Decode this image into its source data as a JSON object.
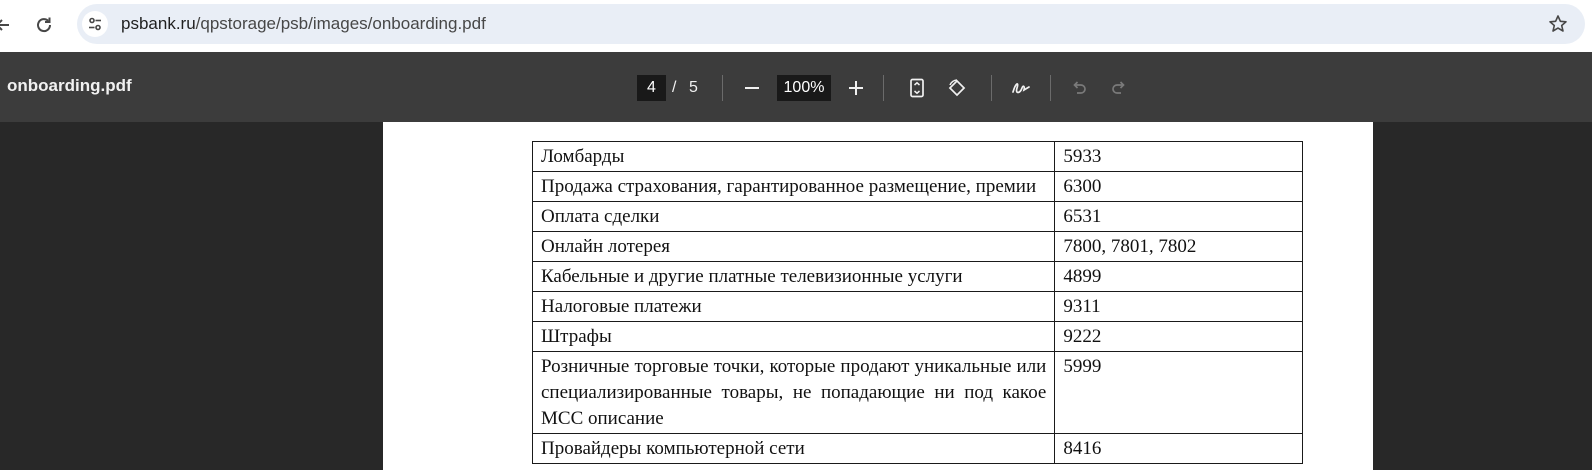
{
  "browser": {
    "url_host": "psbank.ru",
    "url_path": "/qpstorage/psb/images/onboarding.pdf",
    "icons": {
      "back": "arrow-left-icon",
      "reload": "reload-icon",
      "site_info": "tune-icon",
      "bookmark": "star-icon"
    }
  },
  "pdf_toolbar": {
    "title": "onboarding.pdf",
    "current_page": "4",
    "page_separator": "/",
    "total_pages": "5",
    "zoom": "100%",
    "icons": [
      "minus-icon",
      "plus-icon",
      "fit-page-icon",
      "rotate-icon",
      "draw-icon",
      "undo-icon",
      "redo-icon"
    ]
  },
  "document": {
    "rows": [
      {
        "name": "Ломбарды",
        "code": "5933"
      },
      {
        "name": "Продажа страхования, гарантированное размещение, премии",
        "code": "6300"
      },
      {
        "name": "Оплата сделки",
        "code": "6531"
      },
      {
        "name": "Онлайн лотерея",
        "code": "7800, 7801, 7802"
      },
      {
        "name": "Кабельные и другие платные телевизионные услуги",
        "code": "4899"
      },
      {
        "name": "Налоговые платежи",
        "code": "9311"
      },
      {
        "name": "Штрафы",
        "code": "9222"
      },
      {
        "name": "Розничные торговые точки, которые продают уникальные или специализированные товары, не попадающие ни под какое МСС описание",
        "code": "5999"
      },
      {
        "name": "Провайдеры компьютерной сети",
        "code": "8416"
      }
    ]
  },
  "colors": {
    "toolbar_bg": "#3c3c3c",
    "viewer_bg": "#282828",
    "omnibox_bg": "#e9eef6"
  }
}
